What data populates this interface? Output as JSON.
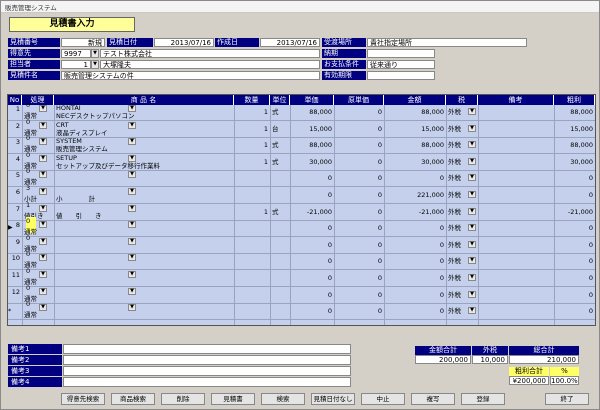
{
  "window": {
    "title": "販売管理システム"
  },
  "form": {
    "title": "見積書入力"
  },
  "header": {
    "quote_no_label": "見積番号",
    "quote_no_value": "新規",
    "quote_date_label": "見積日付",
    "quote_date_value": "2013/07/16",
    "created_label": "作成日",
    "created_value": "2013/07/16",
    "delivery_place_label": "受渡場所",
    "delivery_place_value": "貴社指定場所",
    "customer_label": "得意先",
    "customer_code": "9997",
    "customer_name": "テスト株式会社",
    "due_label": "納期",
    "due_value": "",
    "staff_label": "担当者",
    "staff_code": "1",
    "staff_name": "大塚隆夫",
    "payment_label": "お支払条件",
    "payment_value": "従来通り",
    "subject_label": "見積件名",
    "subject_value": "販売管理システムの件",
    "validity_label": "有効期限",
    "validity_value": ""
  },
  "grid": {
    "columns": [
      "No",
      "処理",
      "商 品 名",
      "数量",
      "単位",
      "単価",
      "原単価",
      "金額",
      "税",
      "備考",
      "粗利"
    ],
    "rows": [
      {
        "no": "1",
        "proc_code": "0",
        "proc": "通常",
        "code": "HONTAI",
        "name": "NECデスクトップパソコン",
        "qty": "1",
        "unit": "式",
        "price": "88,000",
        "cost": "0",
        "amount": "88,000",
        "tax": "外税",
        "note": "",
        "profit": "88,000"
      },
      {
        "no": "2",
        "proc_code": "0",
        "proc": "通常",
        "code": "CRT",
        "name": "液晶ディスプレイ",
        "qty": "1",
        "unit": "台",
        "price": "15,000",
        "cost": "0",
        "amount": "15,000",
        "tax": "外税",
        "note": "",
        "profit": "15,000"
      },
      {
        "no": "3",
        "proc_code": "0",
        "proc": "通常",
        "code": "SYSTEM",
        "name": "販売管理システム",
        "qty": "1",
        "unit": "式",
        "price": "88,000",
        "cost": "0",
        "amount": "88,000",
        "tax": "外税",
        "note": "",
        "profit": "88,000"
      },
      {
        "no": "4",
        "proc_code": "0",
        "proc": "通常",
        "code": "SETUP",
        "name": "セットアップ及びデータ移行作業料",
        "qty": "1",
        "unit": "式",
        "price": "30,000",
        "cost": "0",
        "amount": "30,000",
        "tax": "外税",
        "note": "",
        "profit": "30,000"
      },
      {
        "no": "5",
        "proc_code": "0",
        "proc": "通常",
        "code": "",
        "name": "",
        "qty": "",
        "unit": "",
        "price": "0",
        "cost": "0",
        "amount": "0",
        "tax": "外税",
        "note": "",
        "profit": "0"
      },
      {
        "no": "6",
        "proc_code": "3",
        "proc": "小計",
        "code": "",
        "name": "小　　　　計",
        "qty": "",
        "unit": "",
        "price": "0",
        "cost": "0",
        "amount": "221,000",
        "tax": "外税",
        "note": "",
        "profit": "0"
      },
      {
        "no": "7",
        "proc_code": "1",
        "proc": "値引き",
        "code": "",
        "name": "値　　引　　き",
        "qty": "1",
        "unit": "式",
        "price": "-21,000",
        "cost": "0",
        "amount": "-21,000",
        "tax": "外税",
        "note": "",
        "profit": "-21,000"
      },
      {
        "no": "8",
        "proc_code": "0",
        "proc": "通常",
        "code": "",
        "name": "",
        "qty": "",
        "unit": "",
        "price": "0",
        "cost": "0",
        "amount": "0",
        "tax": "外税",
        "note": "",
        "profit": "0"
      },
      {
        "no": "9",
        "proc_code": "0",
        "proc": "通常",
        "code": "",
        "name": "",
        "qty": "",
        "unit": "",
        "price": "0",
        "cost": "0",
        "amount": "0",
        "tax": "外税",
        "note": "",
        "profit": "0"
      },
      {
        "no": "10",
        "proc_code": "0",
        "proc": "通常",
        "code": "",
        "name": "",
        "qty": "",
        "unit": "",
        "price": "0",
        "cost": "0",
        "amount": "0",
        "tax": "外税",
        "note": "",
        "profit": "0"
      },
      {
        "no": "11",
        "proc_code": "0",
        "proc": "通常",
        "code": "",
        "name": "",
        "qty": "",
        "unit": "",
        "price": "0",
        "cost": "0",
        "amount": "0",
        "tax": "外税",
        "note": "",
        "profit": "0"
      },
      {
        "no": "12",
        "proc_code": "0",
        "proc": "通常",
        "code": "",
        "name": "",
        "qty": "",
        "unit": "",
        "price": "0",
        "cost": "0",
        "amount": "0",
        "tax": "外税",
        "note": "",
        "profit": "0"
      },
      {
        "no": "",
        "proc_code": "0",
        "proc": "通常",
        "code": "",
        "name": "",
        "qty": "",
        "unit": "",
        "price": "0",
        "cost": "0",
        "amount": "0",
        "tax": "外税",
        "note": "",
        "profit": "0"
      }
    ],
    "new_row_marker": "*",
    "current_row_marker": "▶"
  },
  "remarks": {
    "labels": [
      "備考1",
      "備考2",
      "備考3",
      "備考4"
    ],
    "values": [
      "",
      "",
      "",
      ""
    ]
  },
  "totals": {
    "amount_total_label": "金額合計",
    "amount_total_value": "200,000",
    "tax_label": "外税",
    "tax_value": "10,000",
    "grand_total_label": "総合計",
    "grand_total_value": "210,000",
    "profit_total_label": "粗利合計",
    "profit_total_value": "¥200,000",
    "percent_label": "%",
    "percent_value": "100.0%"
  },
  "buttons": [
    "得意先検索",
    "商品検索",
    "削除",
    "見積書",
    "検索",
    "見積日付なし",
    "中止",
    "複写",
    "登録",
    "終了"
  ],
  "colors": {
    "label_bg": "#000080",
    "grid_bg": "#c4d0ec",
    "title_bg": "#ffff99",
    "highlight": "#ffff66"
  }
}
